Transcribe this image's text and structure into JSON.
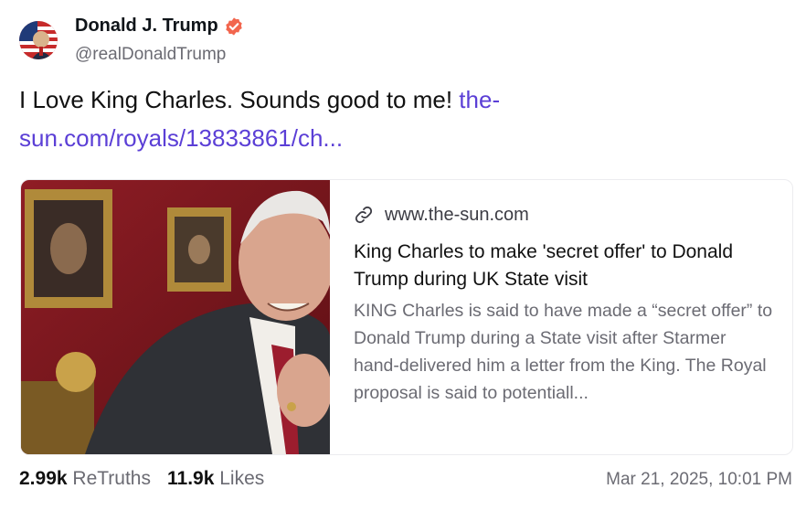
{
  "author": {
    "name": "Donald J. Trump",
    "handle": "@realDonaldTrump",
    "avatar_icon": "flag-avatar",
    "verified_icon": "verified-badge-icon",
    "verified_color": "#f2664e"
  },
  "post": {
    "text": "I Love King Charles. Sounds good to me! ",
    "link_text": "the-sun.com/royals/13833861/ch..."
  },
  "card": {
    "link_icon": "link-icon",
    "domain": "www.the-sun.com",
    "title": "King Charles to make 'secret offer' to Donald Trump during UK State visit",
    "description": "KING Charles is said to have made a “secret offer” to Donald Trump during a State visit after Starmer hand-delivered him a letter from the King. The Royal proposal is said to potentiall..."
  },
  "stats": {
    "retruths_count": "2.99k",
    "retruths_label": "ReTruths",
    "likes_count": "11.9k",
    "likes_label": "Likes"
  },
  "timestamp": "Mar 21, 2025, 10:01 PM",
  "colors": {
    "link": "#5b3fd6",
    "muted": "#6b6b73"
  }
}
